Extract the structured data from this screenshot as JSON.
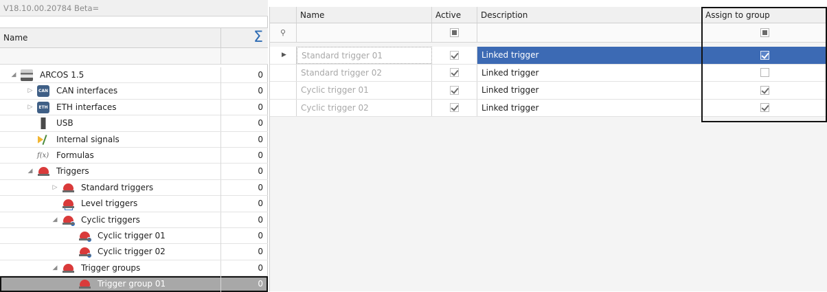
{
  "left": {
    "version": "V18.10.00.20784 Beta=",
    "header": {
      "name": "Name",
      "sum_symbol": "Σ"
    },
    "tree": [
      {
        "label": "ARCOS 1.5",
        "count": "0",
        "level": 0,
        "expander": "◢",
        "icon": "device-icon"
      },
      {
        "label": "CAN interfaces",
        "count": "0",
        "level": 1,
        "expander": "▷",
        "icon": "can-icon"
      },
      {
        "label": "ETH interfaces",
        "count": "0",
        "level": 1,
        "expander": "▷",
        "icon": "eth-icon"
      },
      {
        "label": "USB",
        "count": "0",
        "level": 1,
        "expander": "",
        "icon": "usb-icon"
      },
      {
        "label": "Internal signals",
        "count": "0",
        "level": 1,
        "expander": "",
        "icon": "internal-signals-icon"
      },
      {
        "label": "Formulas",
        "count": "0",
        "level": 1,
        "expander": "",
        "icon": "formula-icon"
      },
      {
        "label": "Triggers",
        "count": "0",
        "level": 1,
        "expander": "◢",
        "icon": "trigger-icon"
      },
      {
        "label": "Standard triggers",
        "count": "0",
        "level": 2,
        "expander": "▷",
        "icon": "trigger-icon"
      },
      {
        "label": "Level triggers",
        "count": "0",
        "level": 2,
        "expander": "",
        "icon": "level-trigger-icon"
      },
      {
        "label": "Cyclic triggers",
        "count": "0",
        "level": 2,
        "expander": "◢",
        "icon": "cyclic-trigger-icon"
      },
      {
        "label": "Cyclic trigger 01",
        "count": "0",
        "level": 3,
        "expander": "",
        "icon": "cyclic-trigger-icon"
      },
      {
        "label": "Cyclic trigger 02",
        "count": "0",
        "level": 3,
        "expander": "",
        "icon": "cyclic-trigger-icon"
      },
      {
        "label": "Trigger groups",
        "count": "0",
        "level": 2,
        "expander": "◢",
        "icon": "trigger-group-icon"
      },
      {
        "label": "Trigger group 01",
        "count": "0",
        "level": 3,
        "expander": "",
        "icon": "trigger-group-icon",
        "selected": true
      }
    ]
  },
  "grid": {
    "columns": {
      "name": "Name",
      "active": "Active",
      "description": "Description",
      "assign": "Assign to group"
    },
    "filter_pin": "⚲",
    "rows": [
      {
        "name": "Standard trigger 01",
        "active": true,
        "description": "Linked trigger",
        "assign": true,
        "current": true
      },
      {
        "name": "Standard trigger 02",
        "active": true,
        "description": "Linked trigger",
        "assign": false,
        "current": false
      },
      {
        "name": "Cyclic trigger 01",
        "active": true,
        "description": "Linked trigger",
        "assign": true,
        "current": false
      },
      {
        "name": "Cyclic trigger 02",
        "active": true,
        "description": "Linked trigger",
        "assign": true,
        "current": false
      }
    ]
  },
  "colors": {
    "selection_blue": "#3c6ab4",
    "selected_tree_row": "#a8a8a8",
    "sum_icon": "#2d6bb3"
  }
}
